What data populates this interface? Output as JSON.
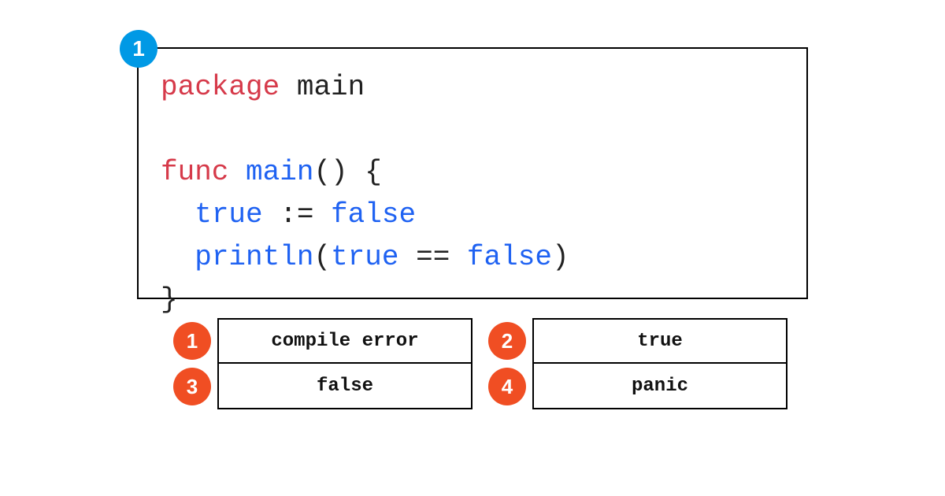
{
  "question_number": "1",
  "code": {
    "line1": {
      "kw": "package",
      "sp": " ",
      "name": "main"
    },
    "line2": {
      "kw": "func",
      "sp": " ",
      "name": "main",
      "tail": "() {"
    },
    "line3": {
      "indent": "  ",
      "lhs": "true",
      "op": " := ",
      "rhs": "false"
    },
    "line4": {
      "indent": "  ",
      "fn": "println",
      "open": "(",
      "arg1": "true",
      "op": " == ",
      "arg2": "false",
      "close": ")"
    },
    "line5": {
      "brace": "}"
    }
  },
  "answers": [
    {
      "num": "1",
      "label": "compile error"
    },
    {
      "num": "2",
      "label": "true"
    },
    {
      "num": "3",
      "label": "false"
    },
    {
      "num": "4",
      "label": "panic"
    }
  ]
}
